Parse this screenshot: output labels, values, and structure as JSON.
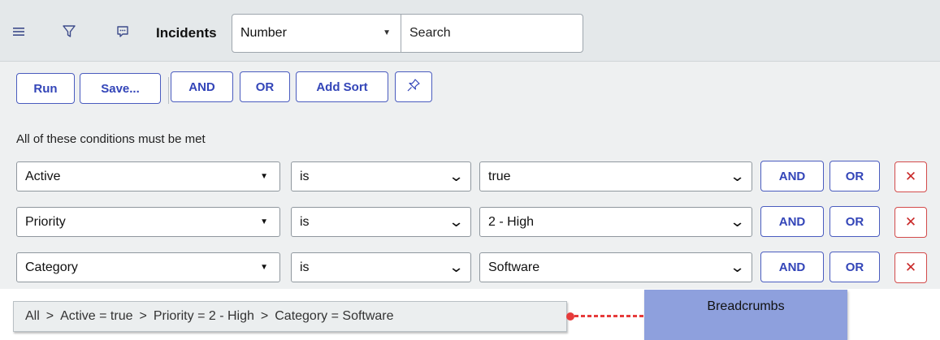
{
  "header": {
    "title": "Incidents",
    "field_select": {
      "value": "Number"
    },
    "search": {
      "value": "",
      "placeholder": "Search"
    },
    "icons": [
      "hamburger-menu-icon",
      "filter-icon",
      "chat-bubble-icon"
    ]
  },
  "toolbar": {
    "run_label": "Run",
    "save_label": "Save...",
    "and_label": "AND",
    "or_label": "OR",
    "add_sort_label": "Add Sort",
    "pin_icon": "pin-icon"
  },
  "conditions": {
    "label": "All of these conditions must be met",
    "rows": [
      {
        "field": "Active",
        "operator": "is",
        "value": "true",
        "and_label": "AND",
        "or_label": "OR",
        "remove_label": "✕"
      },
      {
        "field": "Priority",
        "operator": "is",
        "value": "2 - High",
        "and_label": "AND",
        "or_label": "OR",
        "remove_label": "✕"
      },
      {
        "field": "Category",
        "operator": "is",
        "value": "Software",
        "and_label": "AND",
        "or_label": "OR",
        "remove_label": "✕"
      }
    ]
  },
  "breadcrumbs": {
    "separator": ">",
    "items": [
      "All",
      "Active = true",
      "Priority = 2 - High",
      "Category = Software"
    ]
  },
  "callout": {
    "label": "Breadcrumbs"
  },
  "colors": {
    "accent": "#3345b8",
    "danger": "#c92828",
    "callout_bg": "#8ea0dd",
    "pointer": "#e63b3b"
  }
}
